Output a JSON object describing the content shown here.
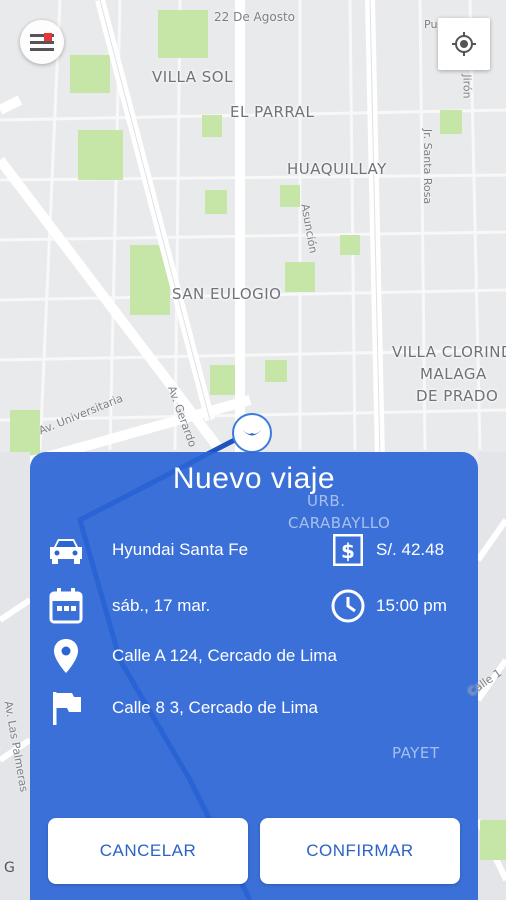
{
  "map": {
    "neighborhoods": [
      "VILLA SOL",
      "EL PARRAL",
      "HUAQUILLAY",
      "SAN EULOGIO",
      "VILLA CLORINDA",
      "MALAGA",
      "DE PRADO",
      "URB.",
      "CARABAYLLO",
      "PAYET"
    ],
    "streets": [
      "22 De Agosto",
      "Av. Universitaria",
      "Av. Gerardo",
      "Asunción",
      "Jr. Santa Rosa",
      "Calle 1",
      "Av. Las Palmeras",
      "Puno",
      "Jirón"
    ]
  },
  "card": {
    "title": "Nuevo viaje",
    "vehicle": "Hyundai Santa Fe",
    "price": "S/. 42.48",
    "date": "sáb., 17 mar.",
    "time": "15:00 pm",
    "origin": "Calle A 124, Cercado de Lima",
    "destination": "Calle 8 3, Cercado de Lima",
    "cancel_label": "CANCELAR",
    "confirm_label": "CONFIRMAR"
  },
  "colors": {
    "accent": "#2a65d6",
    "button_text": "#2a62c8"
  },
  "icons": [
    "menu-icon",
    "my-location-icon",
    "car-icon",
    "price-icon",
    "calendar-icon",
    "clock-icon",
    "location-pin-icon",
    "flag-icon"
  ]
}
